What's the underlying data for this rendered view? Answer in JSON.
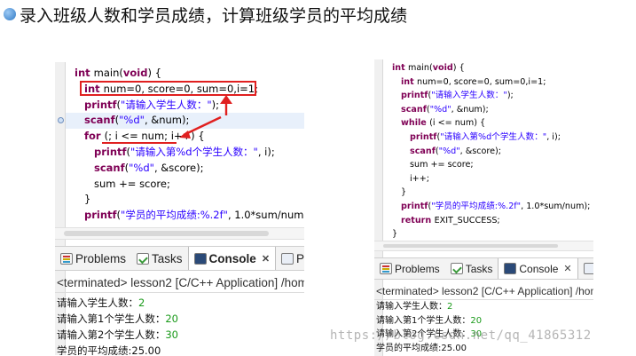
{
  "title": "录入班级人数和学员成绩，计算班级学员的平均成绩",
  "left": {
    "code": [
      {
        "parts": [
          [
            "kw",
            "int "
          ],
          [
            "",
            "main("
          ],
          [
            "kw",
            "void"
          ],
          [
            "",
            ") {"
          ]
        ]
      },
      {
        "parts": [
          [
            "kw",
            "int "
          ],
          [
            "",
            "num=0, score=0, sum=0,i=1;"
          ]
        ]
      },
      {
        "parts": [
          [
            "fn",
            "printf"
          ],
          [
            "",
            "("
          ],
          [
            "str",
            "\"请输入学生人数：\""
          ],
          [
            "",
            ");"
          ]
        ]
      },
      {
        "parts": [
          [
            "fn",
            "scanf"
          ],
          [
            "",
            "("
          ],
          [
            "str",
            "\"%d\""
          ],
          [
            "",
            ", &num);"
          ]
        ]
      },
      {
        "parts": [
          [
            "kw",
            "for "
          ],
          [
            "",
            "(; i <= num; i++) {"
          ]
        ]
      },
      {
        "parts": [
          [
            "fn",
            "printf"
          ],
          [
            "",
            "("
          ],
          [
            "str",
            "\"请输入第%d个学生人数：\""
          ],
          [
            "",
            ", i);"
          ]
        ]
      },
      {
        "parts": [
          [
            "fn",
            "scanf"
          ],
          [
            "",
            "("
          ],
          [
            "str",
            "\"%d\""
          ],
          [
            "",
            ", &score);"
          ]
        ]
      },
      {
        "parts": [
          [
            "",
            "sum += score;"
          ]
        ]
      },
      {
        "parts": [
          [
            "",
            "}"
          ]
        ]
      },
      {
        "parts": [
          [
            "fn",
            "printf"
          ],
          [
            "",
            "("
          ],
          [
            "str",
            "\"学员的平均成绩:%.2f\""
          ],
          [
            "",
            ", 1.0*sum/num);"
          ]
        ]
      }
    ],
    "tabs": [
      "Problems",
      "Tasks",
      "Console",
      "Pr"
    ],
    "close_glyph": "✕",
    "terminated": "<terminated> lesson2 [C/C++ Application] /hom",
    "output": [
      {
        "label": "请输入学生人数：",
        "value": "2"
      },
      {
        "label": "请输入第1个学生人数：",
        "value": "20"
      },
      {
        "label": "请输入第2个学生人数：",
        "value": "30"
      },
      {
        "label": "学员的平均成绩:25.00",
        "value": ""
      }
    ]
  },
  "right": {
    "code": [
      {
        "parts": [
          [
            "kw",
            "int "
          ],
          [
            "",
            "main("
          ],
          [
            "kw",
            "void"
          ],
          [
            "",
            ") {"
          ]
        ]
      },
      {
        "parts": [
          [
            "kw",
            "int "
          ],
          [
            "",
            "num=0, score=0, sum=0,i=1;"
          ]
        ]
      },
      {
        "parts": [
          [
            "fn",
            "printf"
          ],
          [
            "",
            "("
          ],
          [
            "str",
            "\"请输入学生人数：\""
          ],
          [
            "",
            ");"
          ]
        ]
      },
      {
        "parts": [
          [
            "fn",
            "scanf"
          ],
          [
            "",
            "("
          ],
          [
            "str",
            "\"%d\""
          ],
          [
            "",
            ", &num);"
          ]
        ]
      },
      {
        "parts": [
          [
            "kw",
            "while "
          ],
          [
            "",
            "(i <= num) {"
          ]
        ]
      },
      {
        "parts": [
          [
            "fn",
            "printf"
          ],
          [
            "",
            "("
          ],
          [
            "str",
            "\"请输入第%d个学生人数：\""
          ],
          [
            "",
            ", i);"
          ]
        ]
      },
      {
        "parts": [
          [
            "fn",
            "scanf"
          ],
          [
            "",
            "("
          ],
          [
            "str",
            "\"%d\""
          ],
          [
            "",
            ", &score);"
          ]
        ]
      },
      {
        "parts": [
          [
            "",
            "sum += score;"
          ]
        ]
      },
      {
        "parts": [
          [
            "",
            "i++;"
          ]
        ]
      },
      {
        "parts": [
          [
            "",
            "}"
          ]
        ]
      },
      {
        "parts": [
          [
            "fn",
            "printf"
          ],
          [
            "",
            "("
          ],
          [
            "str",
            "\"学员的平均成绩:%.2f\""
          ],
          [
            "",
            ", 1.0*sum/num);"
          ]
        ]
      },
      {
        "parts": [
          [
            "kw",
            "return "
          ],
          [
            "",
            "EXIT_SUCCESS;"
          ]
        ]
      },
      {
        "parts": [
          [
            "",
            "}"
          ]
        ]
      }
    ],
    "tabs": [
      "Problems",
      "Tasks",
      "Console",
      "P"
    ],
    "close_glyph": "✕",
    "terminated": "<terminated> lesson2 [C/C++ Application] /hom",
    "output": [
      {
        "label": "请输入学生人数：",
        "value": "2"
      },
      {
        "label": "请输入第1个学生人数：",
        "value": "20"
      },
      {
        "label": "请输入第2个学生人数：",
        "value": "30"
      },
      {
        "label": "学员的平均成绩:25.00",
        "value": ""
      }
    ]
  },
  "watermark": "https://blog.csdn.net/qq_41865312",
  "colors": {
    "keyword": "#7f0055",
    "string": "#2a00ff",
    "output_value": "#1a9a1a",
    "annotation": "#e02020"
  }
}
